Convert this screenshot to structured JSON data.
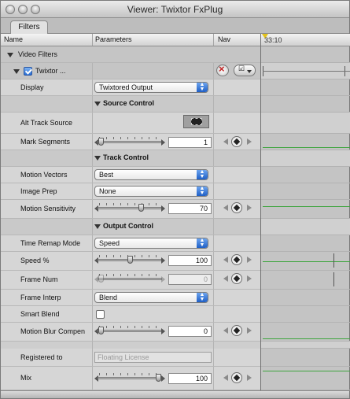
{
  "window": {
    "title": "Viewer: Twixtor FxPlug"
  },
  "tabs": [
    {
      "label": "Filters"
    }
  ],
  "columns": {
    "name": "Name",
    "parameters": "Parameters",
    "nav": "Nav"
  },
  "timeline": {
    "timecode": "33:10"
  },
  "video_filters": {
    "label": "Video Filters"
  },
  "filter": {
    "name": "Twixtor ...",
    "enabled": true
  },
  "display": {
    "label": "Display",
    "value": "Twixtored Output"
  },
  "source_control": {
    "title": "Source Control"
  },
  "alt_track_source": {
    "label": "Alt Track Source"
  },
  "mark_segments": {
    "label": "Mark Segments",
    "value": "1",
    "fraction": 0.0
  },
  "track_control": {
    "title": "Track Control"
  },
  "motion_vectors": {
    "label": "Motion Vectors",
    "value": "Best"
  },
  "image_prep": {
    "label": "Image Prep",
    "value": "None"
  },
  "motion_sensitivity": {
    "label": "Motion Sensitivity",
    "value": "70",
    "fraction": 0.7
  },
  "output_control": {
    "title": "Output Control"
  },
  "time_remap_mode": {
    "label": "Time Remap Mode",
    "value": "Speed"
  },
  "speed": {
    "label": "Speed %",
    "value": "100",
    "fraction": 0.5
  },
  "frame_num": {
    "label": "Frame Num",
    "value": "0",
    "fraction": 0.0
  },
  "frame_interp": {
    "label": "Frame Interp",
    "value": "Blend"
  },
  "smart_blend": {
    "label": "Smart Blend",
    "checked": false
  },
  "motion_blur": {
    "label": "Motion Blur Compen",
    "value": "0",
    "fraction": 0.0
  },
  "registered_to": {
    "label": "Registered to",
    "value": "Floating License"
  },
  "mix": {
    "label": "Mix",
    "value": "100",
    "fraction": 1.0
  },
  "colors": {
    "keyframe_line": "#3fa53f",
    "popup_arrow": "#2a6fd6",
    "playhead": "#e3c21a"
  }
}
